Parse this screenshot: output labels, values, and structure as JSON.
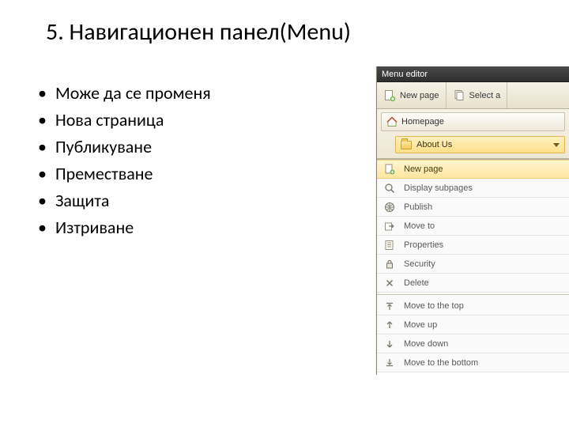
{
  "slide": {
    "title": "5. Навигационен панел(Menu)",
    "bullets": [
      "Може да се променя",
      "Нова страница",
      "Публикуване",
      "Преместване",
      "Защита",
      "Изтриване"
    ]
  },
  "panel": {
    "title": "Menu editor",
    "toolbar": {
      "new_page": "New page",
      "select": "Select a"
    },
    "tree": {
      "root": "Homepage",
      "child": "About Us"
    },
    "context_menu": [
      {
        "id": "new-page",
        "label": "New page",
        "icon": "new-page-icon"
      },
      {
        "id": "display-sub",
        "label": "Display subpages",
        "icon": "magnifier-icon"
      },
      {
        "id": "publish",
        "label": "Publish",
        "icon": "publish-icon"
      },
      {
        "id": "move-to",
        "label": "Move to",
        "icon": "move-icon"
      },
      {
        "id": "properties",
        "label": "Properties",
        "icon": "properties-icon"
      },
      {
        "id": "security",
        "label": "Security",
        "icon": "lock-icon"
      },
      {
        "id": "delete",
        "label": "Delete",
        "icon": "delete-icon"
      },
      {
        "sep": true
      },
      {
        "id": "move-top",
        "label": "Move to the top",
        "icon": "move-top-icon"
      },
      {
        "id": "move-up",
        "label": "Move up",
        "icon": "move-up-icon"
      },
      {
        "id": "move-down",
        "label": "Move down",
        "icon": "move-down-icon"
      },
      {
        "id": "move-bottom",
        "label": "Move to the bottom",
        "icon": "move-bottom-icon"
      }
    ],
    "selected": "new-page"
  },
  "colors": {
    "accent": "#ffe08a",
    "panel_header": "#3a3a3a"
  }
}
